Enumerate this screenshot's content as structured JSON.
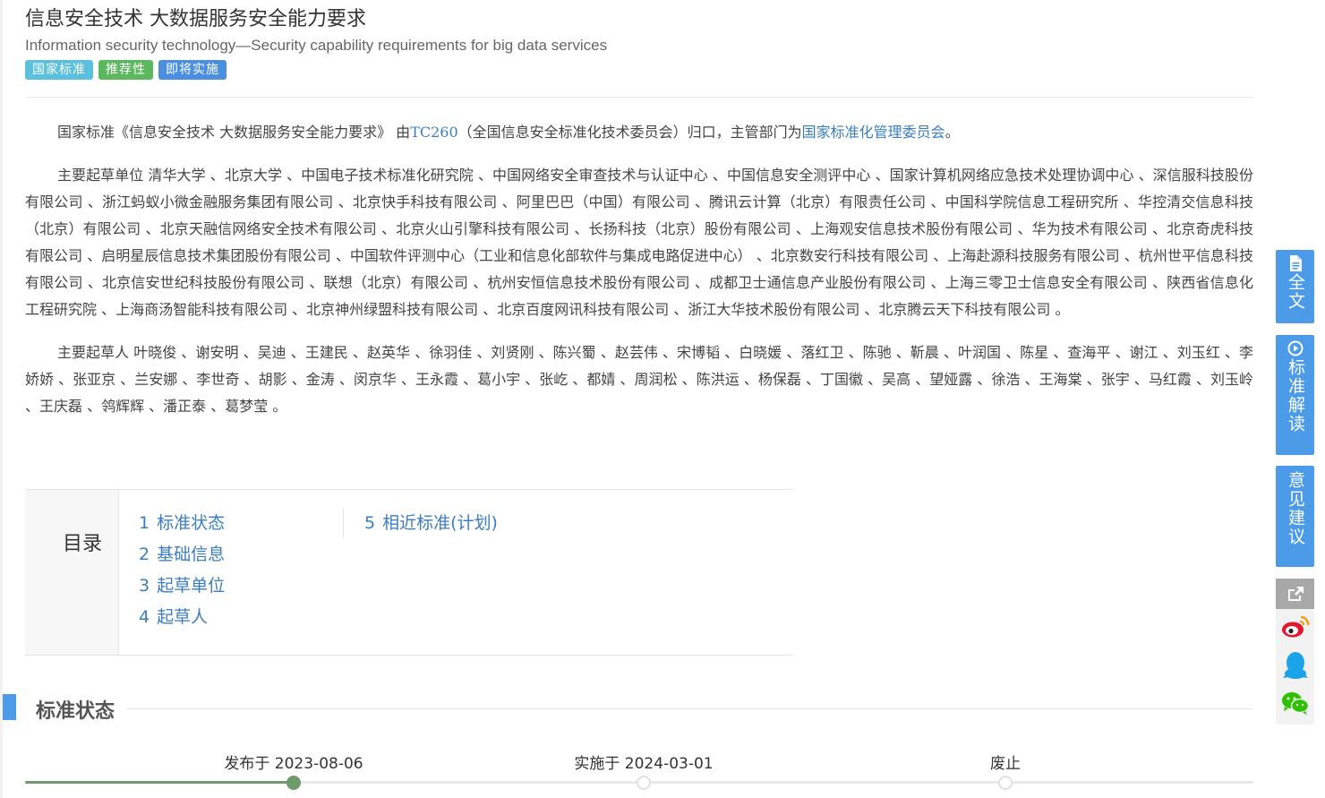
{
  "header": {
    "title": "信息安全技术 大数据服务安全能力要求",
    "subtitle": "Information security technology—Security capability requirements for big data services",
    "badges": [
      {
        "label": "国家标准",
        "color": "#5bc0de"
      },
      {
        "label": "推荐性",
        "color": "#5cb85c"
      },
      {
        "label": "即将实施",
        "color": "#4b8fe0"
      }
    ]
  },
  "intro": {
    "prefix": "国家标准《信息安全技术 大数据服务安全能力要求》 由",
    "tc_link": "TC260",
    "middle": "（全国信息安全标准化技术委员会）归口，主管部门为",
    "dept_link": "国家标准化管理委员会",
    "suffix": "。"
  },
  "drafting_units": {
    "label": "主要起草单位",
    "text": "清华大学 、北京大学 、中国电子技术标准化研究院 、中国网络安全审查技术与认证中心 、中国信息安全测评中心 、国家计算机网络应急技术处理协调中心 、深信服科技股份有限公司 、浙江蚂蚁小微金融服务集团有限公司 、北京快手科技有限公司 、阿里巴巴（中国）有限公司 、腾讯云计算（北京）有限责任公司 、中国科学院信息工程研究所 、华控清交信息科技（北京）有限公司 、北京天融信网络安全技术有限公司 、北京火山引擎科技有限公司 、长扬科技（北京）股份有限公司 、上海观安信息技术股份有限公司 、华为技术有限公司 、北京奇虎科技有限公司 、启明星辰信息技术集团股份有限公司 、中国软件评测中心（工业和信息化部软件与集成电路促进中心） 、北京数安行科技有限公司 、上海赴源科技服务有限公司 、杭州世平信息科技有限公司 、北京信安世纪科技股份有限公司 、联想（北京）有限公司 、杭州安恒信息技术股份有限公司 、成都卫士通信息产业股份有限公司 、上海三零卫士信息安全有限公司 、陕西省信息化工程研究院 、上海商汤智能科技有限公司 、北京神州绿盟科技有限公司 、北京百度网讯科技有限公司 、浙江大华技术股份有限公司 、北京腾云天下科技有限公司 。"
  },
  "drafters": {
    "label": "主要起草人",
    "text": "叶晓俊 、谢安明 、吴迪 、王建民 、赵英华 、徐羽佳 、刘贤刚 、陈兴蜀 、赵芸伟 、宋博韬 、白晓媛 、落红卫 、陈驰 、靳晨 、叶润国 、陈星 、查海平 、谢江 、刘玉红 、李娇娇 、张亚京 、兰安娜 、李世奇 、胡影 、金涛 、闵京华 、王永霞 、葛小宇 、张屹 、都婧 、周润松 、陈洪运 、杨保磊 、丁国徽 、吴高 、望娅露 、徐浩 、王海棠 、张宇 、马红霞 、刘玉岭 、王庆磊 、鸰辉辉 、潘正泰 、葛梦莹 。"
  },
  "toc": {
    "label": "目录",
    "items": [
      {
        "num": "1",
        "label": "标准状态"
      },
      {
        "num": "2",
        "label": "基础信息"
      },
      {
        "num": "3",
        "label": "起草单位"
      },
      {
        "num": "4",
        "label": "起草人"
      },
      {
        "num": "5",
        "label": "相近标准(计划)"
      }
    ]
  },
  "status_section": {
    "heading": "标准状态",
    "progress": 0.22,
    "steps": [
      {
        "label": "发布于 2023-08-06",
        "done": true
      },
      {
        "label": "实施于 2024-03-01",
        "done": false
      },
      {
        "label": "废止",
        "done": false
      }
    ]
  },
  "side_tools": {
    "full_text": "全文",
    "interpretation": "标准解读",
    "feedback": "意见建议",
    "accent": "#4b9be8"
  }
}
